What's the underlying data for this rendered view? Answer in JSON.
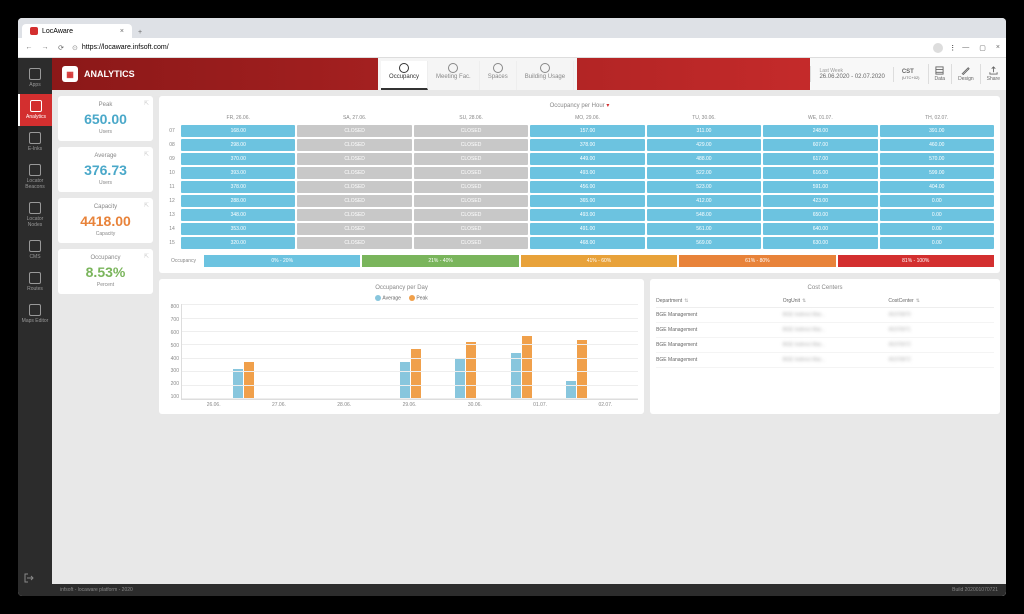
{
  "browser": {
    "tab_title": "LocAware",
    "url": "https://locaware.infsoft.com/"
  },
  "app_title": "ANALYTICS",
  "nav": [
    "Apps",
    "Analytics",
    "E-Inks",
    "Locator Beacons",
    "Locator Nodes",
    "CMS",
    "Routes",
    "Maps Editor"
  ],
  "top_tabs": [
    "Occupancy",
    "Meeting Fac.",
    "Spaces",
    "Building Usage"
  ],
  "period": {
    "label": "Last Week",
    "range": "26.06.2020 - 02.07.2020"
  },
  "tz": {
    "code": "CST",
    "off": "(UTC+02)"
  },
  "tools": [
    "Data",
    "Design",
    "Share"
  ],
  "kpis": [
    {
      "title": "Peak",
      "value": "650.00",
      "unit": "Users",
      "cls": "k-blue"
    },
    {
      "title": "Average",
      "value": "376.73",
      "unit": "Users",
      "cls": "k-blue"
    },
    {
      "title": "Capacity",
      "value": "4418.00",
      "unit": "Capacity",
      "cls": "k-orange"
    },
    {
      "title": "Occupancy",
      "value": "8.53%",
      "unit": "Percent",
      "cls": "k-green"
    }
  ],
  "heatmap": {
    "title": "Occupancy per Hour",
    "days": [
      "FR, 26.06.",
      "SA, 27.06.",
      "SU, 28.06.",
      "MO, 29.06.",
      "TU, 30.06.",
      "WE, 01.07.",
      "TH, 02.07."
    ],
    "hours": [
      "07",
      "08",
      "09",
      "10",
      "11",
      "12",
      "13",
      "14",
      "15"
    ],
    "rows": [
      [
        {
          "v": "168.00",
          "c": "c-blue"
        },
        {
          "v": "CLOSED",
          "c": "c-grey"
        },
        {
          "v": "CLOSED",
          "c": "c-grey"
        },
        {
          "v": "157.00",
          "c": "c-blue"
        },
        {
          "v": "311.00",
          "c": "c-blue"
        },
        {
          "v": "248.00",
          "c": "c-blue"
        },
        {
          "v": "391.00",
          "c": "c-blue"
        }
      ],
      [
        {
          "v": "298.00",
          "c": "c-blue"
        },
        {
          "v": "CLOSED",
          "c": "c-grey"
        },
        {
          "v": "CLOSED",
          "c": "c-grey"
        },
        {
          "v": "378.00",
          "c": "c-blue"
        },
        {
          "v": "429.00",
          "c": "c-blue"
        },
        {
          "v": "607.00",
          "c": "c-blue"
        },
        {
          "v": "460.00",
          "c": "c-blue"
        }
      ],
      [
        {
          "v": "370.00",
          "c": "c-blue"
        },
        {
          "v": "CLOSED",
          "c": "c-grey"
        },
        {
          "v": "CLOSED",
          "c": "c-grey"
        },
        {
          "v": "449.00",
          "c": "c-blue"
        },
        {
          "v": "488.00",
          "c": "c-blue"
        },
        {
          "v": "617.00",
          "c": "c-blue"
        },
        {
          "v": "570.00",
          "c": "c-blue"
        }
      ],
      [
        {
          "v": "393.00",
          "c": "c-blue"
        },
        {
          "v": "CLOSED",
          "c": "c-grey"
        },
        {
          "v": "CLOSED",
          "c": "c-grey"
        },
        {
          "v": "493.00",
          "c": "c-blue"
        },
        {
          "v": "522.00",
          "c": "c-blue"
        },
        {
          "v": "616.00",
          "c": "c-blue"
        },
        {
          "v": "599.00",
          "c": "c-blue"
        }
      ],
      [
        {
          "v": "378.00",
          "c": "c-blue"
        },
        {
          "v": "CLOSED",
          "c": "c-grey"
        },
        {
          "v": "CLOSED",
          "c": "c-grey"
        },
        {
          "v": "456.00",
          "c": "c-blue"
        },
        {
          "v": "523.00",
          "c": "c-blue"
        },
        {
          "v": "591.00",
          "c": "c-blue"
        },
        {
          "v": "404.00",
          "c": "c-blue"
        }
      ],
      [
        {
          "v": "288.00",
          "c": "c-blue"
        },
        {
          "v": "CLOSED",
          "c": "c-grey"
        },
        {
          "v": "CLOSED",
          "c": "c-grey"
        },
        {
          "v": "365.00",
          "c": "c-blue"
        },
        {
          "v": "412.00",
          "c": "c-blue"
        },
        {
          "v": "423.00",
          "c": "c-blue"
        },
        {
          "v": "0.00",
          "c": "c-blue"
        }
      ],
      [
        {
          "v": "348.00",
          "c": "c-blue"
        },
        {
          "v": "CLOSED",
          "c": "c-grey"
        },
        {
          "v": "CLOSED",
          "c": "c-grey"
        },
        {
          "v": "493.00",
          "c": "c-blue"
        },
        {
          "v": "548.00",
          "c": "c-blue"
        },
        {
          "v": "650.00",
          "c": "c-blue"
        },
        {
          "v": "0.00",
          "c": "c-blue"
        }
      ],
      [
        {
          "v": "353.00",
          "c": "c-blue"
        },
        {
          "v": "CLOSED",
          "c": "c-grey"
        },
        {
          "v": "CLOSED",
          "c": "c-grey"
        },
        {
          "v": "491.00",
          "c": "c-blue"
        },
        {
          "v": "561.00",
          "c": "c-blue"
        },
        {
          "v": "640.00",
          "c": "c-blue"
        },
        {
          "v": "0.00",
          "c": "c-blue"
        }
      ],
      [
        {
          "v": "320.00",
          "c": "c-blue"
        },
        {
          "v": "CLOSED",
          "c": "c-grey"
        },
        {
          "v": "CLOSED",
          "c": "c-grey"
        },
        {
          "v": "468.00",
          "c": "c-blue"
        },
        {
          "v": "569.00",
          "c": "c-blue"
        },
        {
          "v": "630.00",
          "c": "c-blue"
        },
        {
          "v": "0.00",
          "c": "c-blue"
        }
      ]
    ],
    "legend_label": "Occupancy",
    "legend": [
      "0% - 20%",
      "21% - 40%",
      "41% - 60%",
      "61% - 80%",
      "81% - 100%"
    ]
  },
  "chart_data": {
    "type": "bar",
    "title": "Occupancy per Day",
    "categories": [
      "26.06.",
      "27.06.",
      "28.06.",
      "29.06.",
      "30.06.",
      "01.07.",
      "02.07."
    ],
    "series": [
      {
        "name": "Average",
        "values": [
          300,
          0,
          0,
          370,
          410,
          460,
          180
        ]
      },
      {
        "name": "Peak",
        "values": [
          370,
          0,
          0,
          500,
          570,
          630,
          590
        ]
      }
    ],
    "ylim": [
      0,
      800
    ],
    "yticks": [
      100,
      200,
      300,
      400,
      500,
      600,
      700,
      800
    ]
  },
  "cost": {
    "title": "Cost Centers",
    "cols": [
      "Department",
      "OrgUnit",
      "CostCenter"
    ],
    "rows": [
      {
        "dept": "BGE Management",
        "ou": "BGE Indirect Mar...",
        "cc": "45370870"
      },
      {
        "dept": "BGE Management",
        "ou": "BGE Indirect Mar...",
        "cc": "45370971"
      },
      {
        "dept": "BGE Management",
        "ou": "BGE Indirect Mar...",
        "cc": "45370972"
      },
      {
        "dept": "BGE Management",
        "ou": "BGE Indirect Mar...",
        "cc": "45370872"
      }
    ]
  },
  "footer": {
    "left": "infsoft - locaware platform - 2020",
    "right": "Build 202001070721"
  }
}
